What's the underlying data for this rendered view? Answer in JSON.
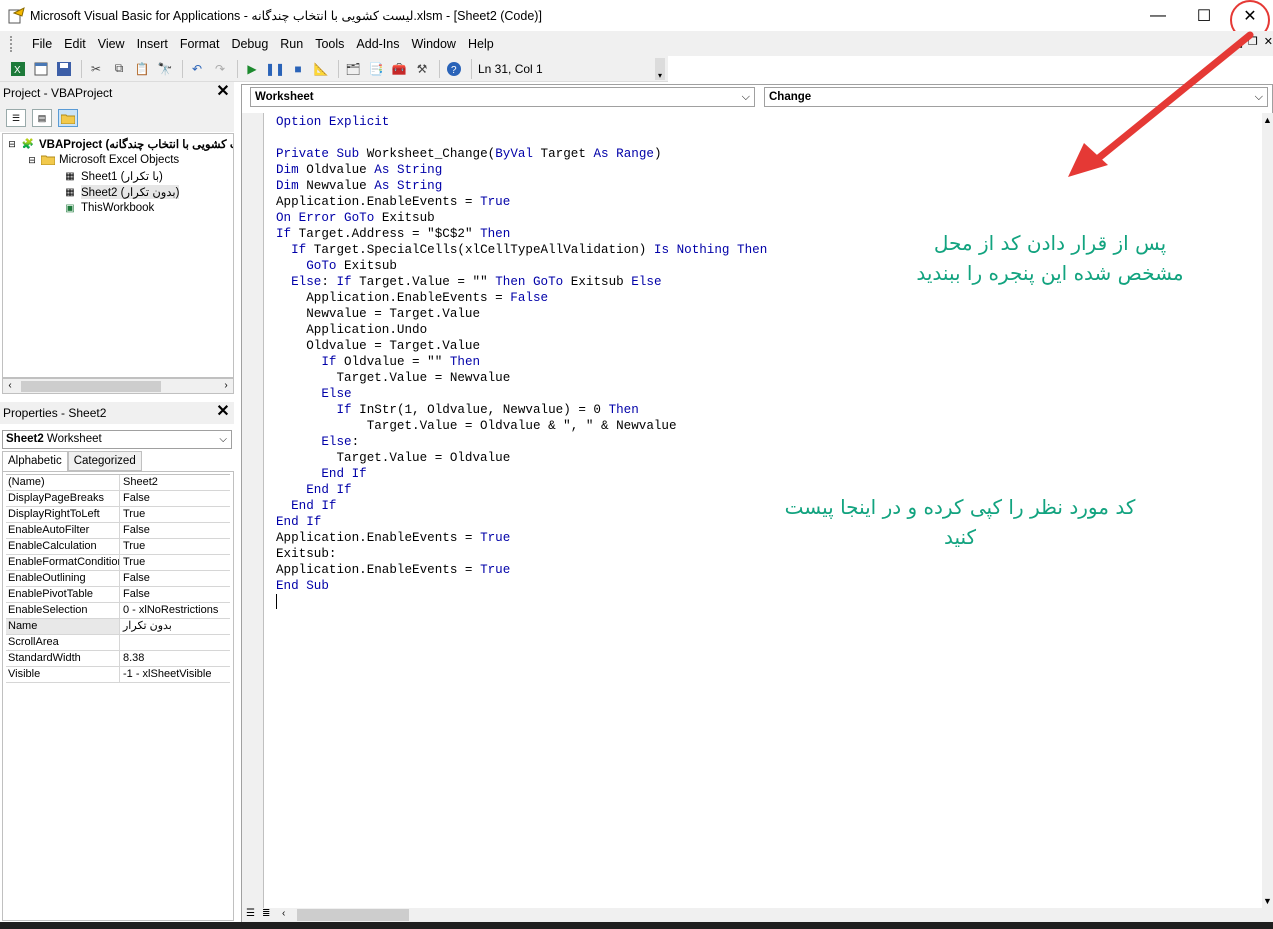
{
  "window": {
    "title": "Microsoft Visual Basic for Applications - لیست کشویی با انتخاب چندگانه.xlsm - [Sheet2 (Code)]",
    "minimize_glyph": "—",
    "maximize_glyph": "☐",
    "close_glyph": "✕"
  },
  "menu": [
    "File",
    "Edit",
    "View",
    "Insert",
    "Format",
    "Debug",
    "Run",
    "Tools",
    "Add-Ins",
    "Window",
    "Help"
  ],
  "toolbar": {
    "position": "Ln 31, Col 1"
  },
  "project": {
    "header": "Project - VBAProject",
    "tree": [
      "VBAProject (لیست کشویی با انتخاب چندگانه)",
      "Microsoft Excel Objects",
      "Sheet1 (با تکرار)",
      "Sheet2 (بدون تکرار)",
      "ThisWorkbook"
    ]
  },
  "properties": {
    "header": "Properties - Sheet2",
    "object_name": "Sheet2",
    "object_type": "Worksheet",
    "tabs": [
      "Alphabetic",
      "Categorized"
    ],
    "rows": [
      [
        "(Name)",
        "Sheet2"
      ],
      [
        "DisplayPageBreaks",
        "False"
      ],
      [
        "DisplayRightToLeft",
        "True"
      ],
      [
        "EnableAutoFilter",
        "False"
      ],
      [
        "EnableCalculation",
        "True"
      ],
      [
        "EnableFormatCondition",
        "True"
      ],
      [
        "EnableOutlining",
        "False"
      ],
      [
        "EnablePivotTable",
        "False"
      ],
      [
        "EnableSelection",
        "0 - xlNoRestrictions"
      ],
      [
        "Name",
        "بدون تکرار"
      ],
      [
        "ScrollArea",
        ""
      ],
      [
        "StandardWidth",
        "8.38"
      ],
      [
        "Visible",
        "-1 - xlSheetVisible"
      ]
    ]
  },
  "code_window": {
    "object_combo": "Worksheet",
    "procedure_combo": "Change",
    "lines": [
      "Option Explicit",
      "",
      "Private Sub Worksheet_Change(ByVal Target As Range)",
      "Dim Oldvalue As String",
      "Dim Newvalue As String",
      "Application.EnableEvents = True",
      "On Error GoTo Exitsub",
      "If Target.Address = \"$C$2\" Then",
      "  If Target.SpecialCells(xlCellTypeAllValidation) Is Nothing Then",
      "    GoTo Exitsub",
      "  Else: If Target.Value = \"\" Then GoTo Exitsub Else",
      "    Application.EnableEvents = False",
      "    Newvalue = Target.Value",
      "    Application.Undo",
      "    Oldvalue = Target.Value",
      "      If Oldvalue = \"\" Then",
      "        Target.Value = Newvalue",
      "      Else",
      "        If InStr(1, Oldvalue, Newvalue) = 0 Then",
      "            Target.Value = Oldvalue & \", \" & Newvalue",
      "      Else:",
      "        Target.Value = Oldvalue",
      "      End If",
      "    End If",
      "  End If",
      "End If",
      "Application.EnableEvents = True",
      "Exitsub:",
      "Application.EnableEvents = True",
      "End Sub"
    ]
  },
  "annotations": {
    "close_hint": "پس از قرار دادن کد از محل مشخص شده این پنجره را ببندید",
    "paste_hint": "کد مورد نظر را کپی کرده و در اینجا پیست کنید",
    "color": "#12a37f",
    "arrow_color": "#e53935"
  },
  "colors": {
    "keyword": "#0000a8",
    "chrome": "#f0f0f0"
  }
}
